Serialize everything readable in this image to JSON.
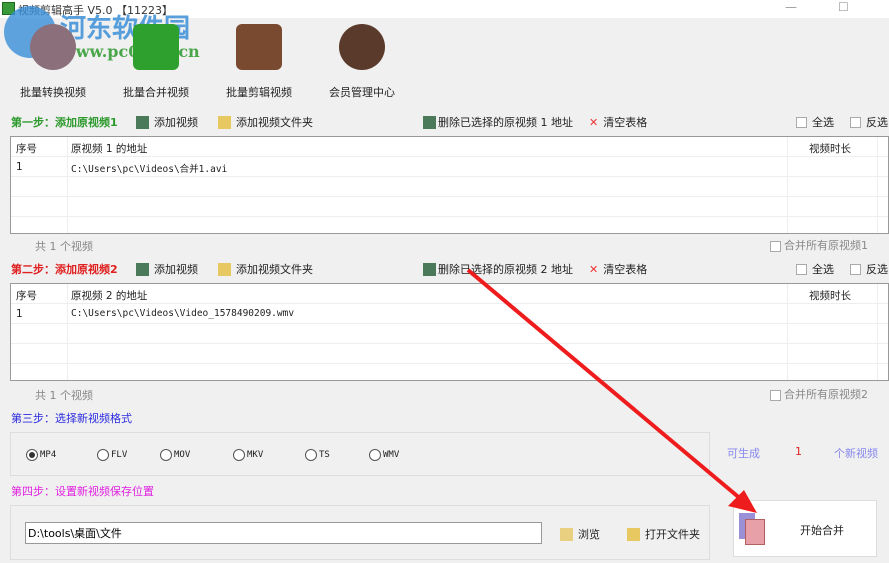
{
  "window": {
    "title": "视频剪辑高手 V5.0  【11223】",
    "minimize": "—",
    "maximize": "☐"
  },
  "watermark": {
    "name": "河东软件园",
    "url": "www.pc0359.cn"
  },
  "toolbar": [
    {
      "label": "批量转换视频",
      "icon": "film-reel-icon"
    },
    {
      "label": "批量合并视频",
      "icon": "merge-film-icon"
    },
    {
      "label": "批量剪辑视频",
      "icon": "cut-film-icon"
    },
    {
      "label": "会员管理中心",
      "icon": "users-icon"
    }
  ],
  "step1": {
    "label": "第一步：添加原视频1",
    "add_video": "添加视频",
    "add_folder": "添加视频文件夹",
    "delete": "删除已选择的原视频 1 地址",
    "clear": "清空表格",
    "select_all": "全选",
    "invert": "反选",
    "headers": [
      "序号",
      "原视频 1 的地址",
      "视频时长"
    ],
    "rows": [
      [
        "1",
        "C:\\Users\\pc\\Videos\\合并1.avi",
        ""
      ]
    ],
    "count": "共 1 个视频",
    "merge_all": "合并所有原视频1"
  },
  "step2": {
    "label": "第二步：添加原视频2",
    "add_video": "添加视频",
    "add_folder": "添加视频文件夹",
    "delete": "删除已选择的原视频 2 地址",
    "clear": "清空表格",
    "select_all": "全选",
    "invert": "反选",
    "headers": [
      "序号",
      "原视频 2 的地址",
      "视频时长"
    ],
    "rows": [
      [
        "1",
        "C:\\Users\\pc\\Videos\\Video_1578490209.wmv",
        ""
      ]
    ],
    "count": "共 1 个视频",
    "merge_all": "合并所有原视频2"
  },
  "step3": {
    "label": "第三步：选择新视频格式",
    "formats": [
      "MP4",
      "FLV",
      "MOV",
      "MKV",
      "TS",
      "WMV"
    ],
    "selected": "MP4"
  },
  "generate": {
    "prefix": "可生成",
    "count": "1",
    "suffix": "个新视频"
  },
  "step4": {
    "label": "第四步：设置新视频保存位置",
    "path": "D:\\tools\\桌面\\文件",
    "browse": "浏览",
    "open_folder": "打开文件夹"
  },
  "start": {
    "label": "开始合并"
  },
  "colors": {
    "step1": "#2e9a2e",
    "step2": "#e02020",
    "step3": "#2a2adf",
    "step4": "#e020e0",
    "arrow": "#ee1c1c"
  }
}
